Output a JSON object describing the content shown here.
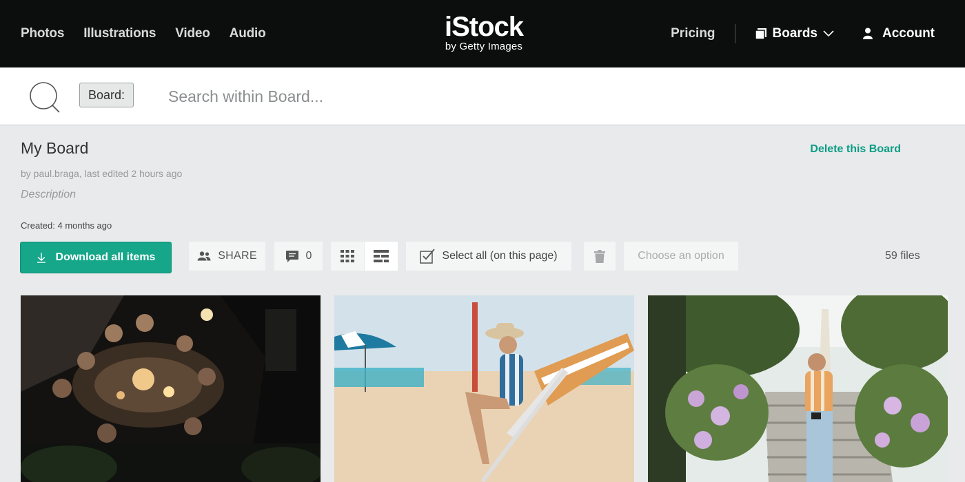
{
  "nav": {
    "left_links": [
      "Photos",
      "Illustrations",
      "Video",
      "Audio"
    ],
    "logo": {
      "main": "iStock",
      "sub": "by Getty Images"
    },
    "pricing": "Pricing",
    "boards": "Boards",
    "account": "Account"
  },
  "search": {
    "chip": "Board:",
    "placeholder": "Search within Board..."
  },
  "board": {
    "title": "My Board",
    "delete_label": "Delete this Board",
    "meta": "by paul.braga, last edited 2 hours ago",
    "description": "Description",
    "created": "Created: 4 months ago"
  },
  "toolbar": {
    "download_label": "Download all items",
    "share_label": "SHARE",
    "comment_count": "0",
    "select_all_label": "Select all (on this page)",
    "choose_option": "Choose an option",
    "files_count": "59 files"
  },
  "colors": {
    "accent": "#16a68a",
    "nav_bg": "#0c0d0d",
    "page_bg": "#e8eaeb"
  },
  "icons": [
    "search-icon",
    "boards-icon",
    "chevron-down-icon",
    "user-icon",
    "download-icon",
    "share-people-icon",
    "comment-icon",
    "grid-view-icon",
    "list-view-icon",
    "select-checkbox-icon",
    "trash-icon"
  ]
}
